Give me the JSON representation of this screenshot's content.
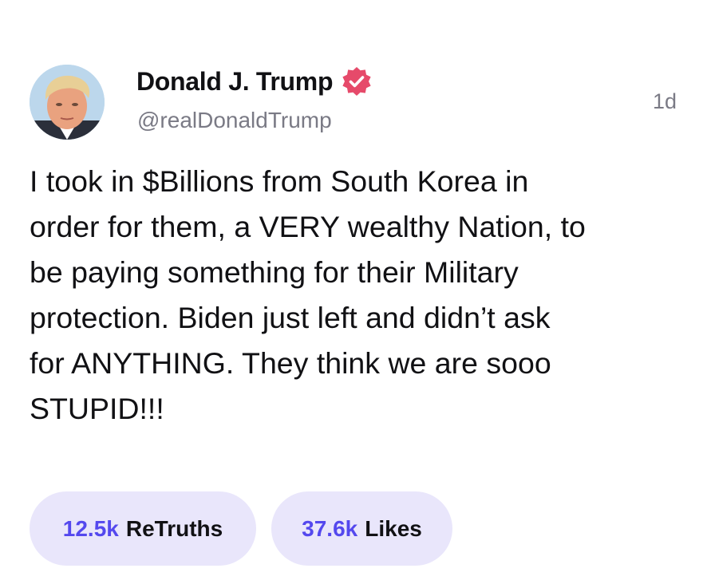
{
  "author": {
    "display_name": "Donald J. Trump",
    "handle": "@realDonaldTrump",
    "verified": true,
    "avatar_icon": "profile-photo"
  },
  "post": {
    "timestamp": "1d",
    "text": "I took in $Billions from South Korea in\norder for them, a VERY wealthy Nation, to\nbe paying something for their Military\nprotection. Biden just left and didn’t ask\nfor ANYTHING. They think we are sooo\nSTUPID!!!"
  },
  "stats": {
    "retruths": {
      "count": "12.5k",
      "label": "ReTruths"
    },
    "likes": {
      "count": "37.6k",
      "label": "Likes"
    }
  },
  "colors": {
    "verified_badge": "#e64a6a",
    "stat_count": "#5448ee",
    "stat_pill_bg": "#e9e6fb",
    "secondary_text": "#7a7a85"
  }
}
